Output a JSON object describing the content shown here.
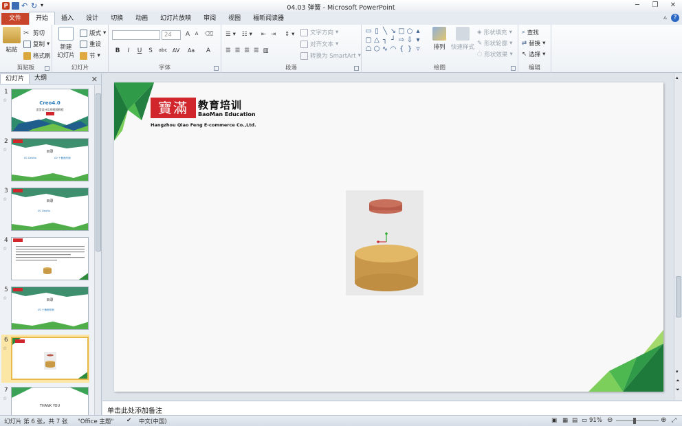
{
  "window": {
    "title": "04.03 弹簧 - Microsoft PowerPoint"
  },
  "tabs": [
    "文件",
    "开始",
    "插入",
    "设计",
    "切换",
    "动画",
    "幻灯片放映",
    "审阅",
    "视图",
    "福昕阅读器"
  ],
  "ribbon": {
    "clipboard": {
      "label": "剪贴板",
      "paste": "粘贴",
      "cut": "剪切",
      "copy": "复制",
      "format_painter": "格式刷"
    },
    "slides": {
      "label": "幻灯片",
      "new_slide": "新建\n幻灯片",
      "new_slide_l1": "新建",
      "new_slide_l2": "幻灯片",
      "layout": "版式",
      "reset": "重设",
      "section": "节"
    },
    "font": {
      "label": "字体",
      "font_size": "24",
      "bold": "B",
      "italic": "I",
      "underline": "U",
      "strike": "S",
      "shadow": "abc",
      "spacing": "AV",
      "case": "Aa",
      "grow": "A",
      "shrink": "A",
      "color": "A"
    },
    "paragraph": {
      "label": "段落",
      "text_direction": "文字方向",
      "align_text": "对齐文本",
      "smartart": "转换为 SmartArt"
    },
    "drawing": {
      "label": "绘图",
      "arrange": "排列",
      "quick_styles": "快速样式",
      "shape_fill": "形状填充",
      "shape_outline": "形状轮廓",
      "shape_effects": "形状效果"
    },
    "editing": {
      "label": "编辑",
      "find": "查找",
      "replace": "替换",
      "select": "选择"
    }
  },
  "left_panel": {
    "tabs": [
      "幻灯片",
      "大纲"
    ],
    "thumbnails": [
      {
        "num": "1",
        "title": "Creo4.0",
        "subtitle": "造型设计实例视频教程"
      },
      {
        "num": "2",
        "title": "目录",
        "items": [
          "Ø1  DeoNo",
          "Ø2  十截面形面"
        ]
      },
      {
        "num": "3",
        "title": "目录",
        "items": [
          "Ø1  DeoNo"
        ]
      },
      {
        "num": "4"
      },
      {
        "num": "5",
        "title": "目录",
        "items": [
          "Ø2  十截面形面"
        ]
      },
      {
        "num": "6"
      },
      {
        "num": "7",
        "title": "THANK YOU"
      }
    ],
    "selected": "6"
  },
  "slide": {
    "logo_chars": "寶滿",
    "logo_title": "教育培训",
    "logo_en": "BaoMan Education",
    "logo_sub": "Hangzhou Qiao Feng E-commerce Co.,Ltd."
  },
  "notes": {
    "placeholder": "单击此处添加备注"
  },
  "statusbar": {
    "slide_info": "幻灯片 第 6 张，共 7 张",
    "theme": "\"Office 主题\"",
    "language": "中文(中国)",
    "zoom": "91%"
  },
  "colors": {
    "file_tab": "#c8442a",
    "logo_red": "#d1262b",
    "green_dark": "#2e8b3d",
    "green_light": "#6cc24a",
    "cylinder": "#d9ae5c",
    "disk": "#b85a4a"
  }
}
